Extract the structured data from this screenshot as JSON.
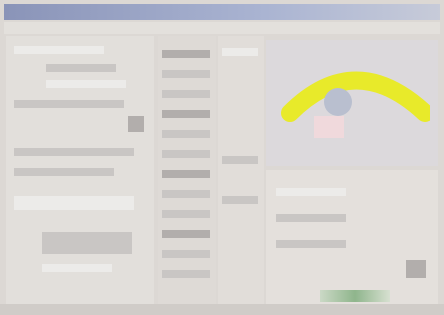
{
  "window": {
    "title": ""
  },
  "menu": [],
  "left": {
    "labels": [
      "",
      "",
      "",
      "",
      "",
      ""
    ]
  },
  "right": {
    "chart": {
      "label": ""
    }
  },
  "status": {
    "text": ""
  },
  "colors": {
    "accent_yellow": "#e8ea2a",
    "titlebar_blue": "#8a94b8",
    "status_green": "#8fb58c"
  }
}
